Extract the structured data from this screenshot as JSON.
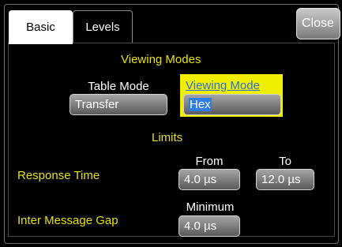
{
  "tabs": [
    {
      "label": "Basic",
      "active": true
    },
    {
      "label": "Levels",
      "active": false
    }
  ],
  "close_label": "Close",
  "sections": {
    "viewing_modes_title": "Viewing Modes",
    "limits_title": "Limits"
  },
  "table_mode": {
    "label": "Table Mode",
    "value": "Transfer"
  },
  "viewing_mode": {
    "label": "Viewing Mode",
    "value": "Hex"
  },
  "response_time": {
    "label": "Response Time",
    "from_label": "From",
    "to_label": "To",
    "from_value": "4.0 µs",
    "to_value": "12.0 µs"
  },
  "inter_message_gap": {
    "label": "Inter Message Gap",
    "minimum_label": "Minimum",
    "minimum_value": "4.0 µs"
  },
  "colors": {
    "accent_yellow": "#e9e200",
    "highlight": "#f1ef00",
    "selection": "#2f7de3"
  }
}
